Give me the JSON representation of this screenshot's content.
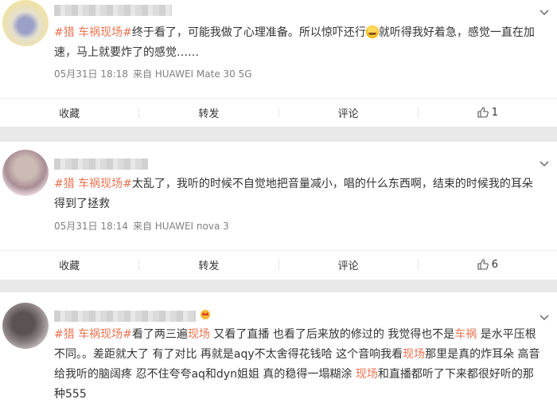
{
  "posts": [
    {
      "topic": "#猎 车祸现场#",
      "text_part1": "终于看了，可能我做了心理准备。所以惊吓还行",
      "emoji": "laughing-crying-emoji",
      "text_part2": "就听得我好着急，感觉一直在加速，马上就要炸了的感觉……",
      "time": "05月31日 18:18",
      "source": "来自 HUAWEI Mate 30 5G",
      "actions": {
        "collect": "收藏",
        "repost": "转发",
        "comment": "评论",
        "likes": "1"
      }
    },
    {
      "topic": "#猎 车祸现场#",
      "text": "太乱了，我听的时候不自觉地把音量减小，唱的什么东西啊，结束的时候我的耳朵得到了拯救",
      "time": "05月31日 18:14",
      "source": "来自 HUAWEI nova 3",
      "actions": {
        "collect": "收藏",
        "repost": "转发",
        "comment": "评论",
        "likes": "6"
      }
    },
    {
      "topic": "#猎 车祸现场#",
      "seg1": "看了两三遍",
      "hl1": "现场",
      "seg2": " 又看了直播 也看了后来放的修过的 我觉得也不是",
      "hl2": "车祸",
      "seg3": " 是水平压根不同。。差距就大了 有了对比 再就是aqy不太舍得花钱哈 这个音响我看",
      "hl3": "现场",
      "seg4": "那里是真的炸耳朵 高音给我听的脑阔疼 忍不住夸夸aq和dyn姐姐 真的稳得一塌糊涂 ",
      "hl4": "现场",
      "seg5": "和直播都听了下来都很好听的那种555"
    }
  ],
  "colors": {
    "accent": "#eb7350",
    "text": "#333333",
    "meta": "#808080",
    "background": "#e9e9e9"
  },
  "icons": {
    "more": "chevron-down-icon",
    "like": "thumbs-up-icon",
    "badge": "crown-icon"
  }
}
